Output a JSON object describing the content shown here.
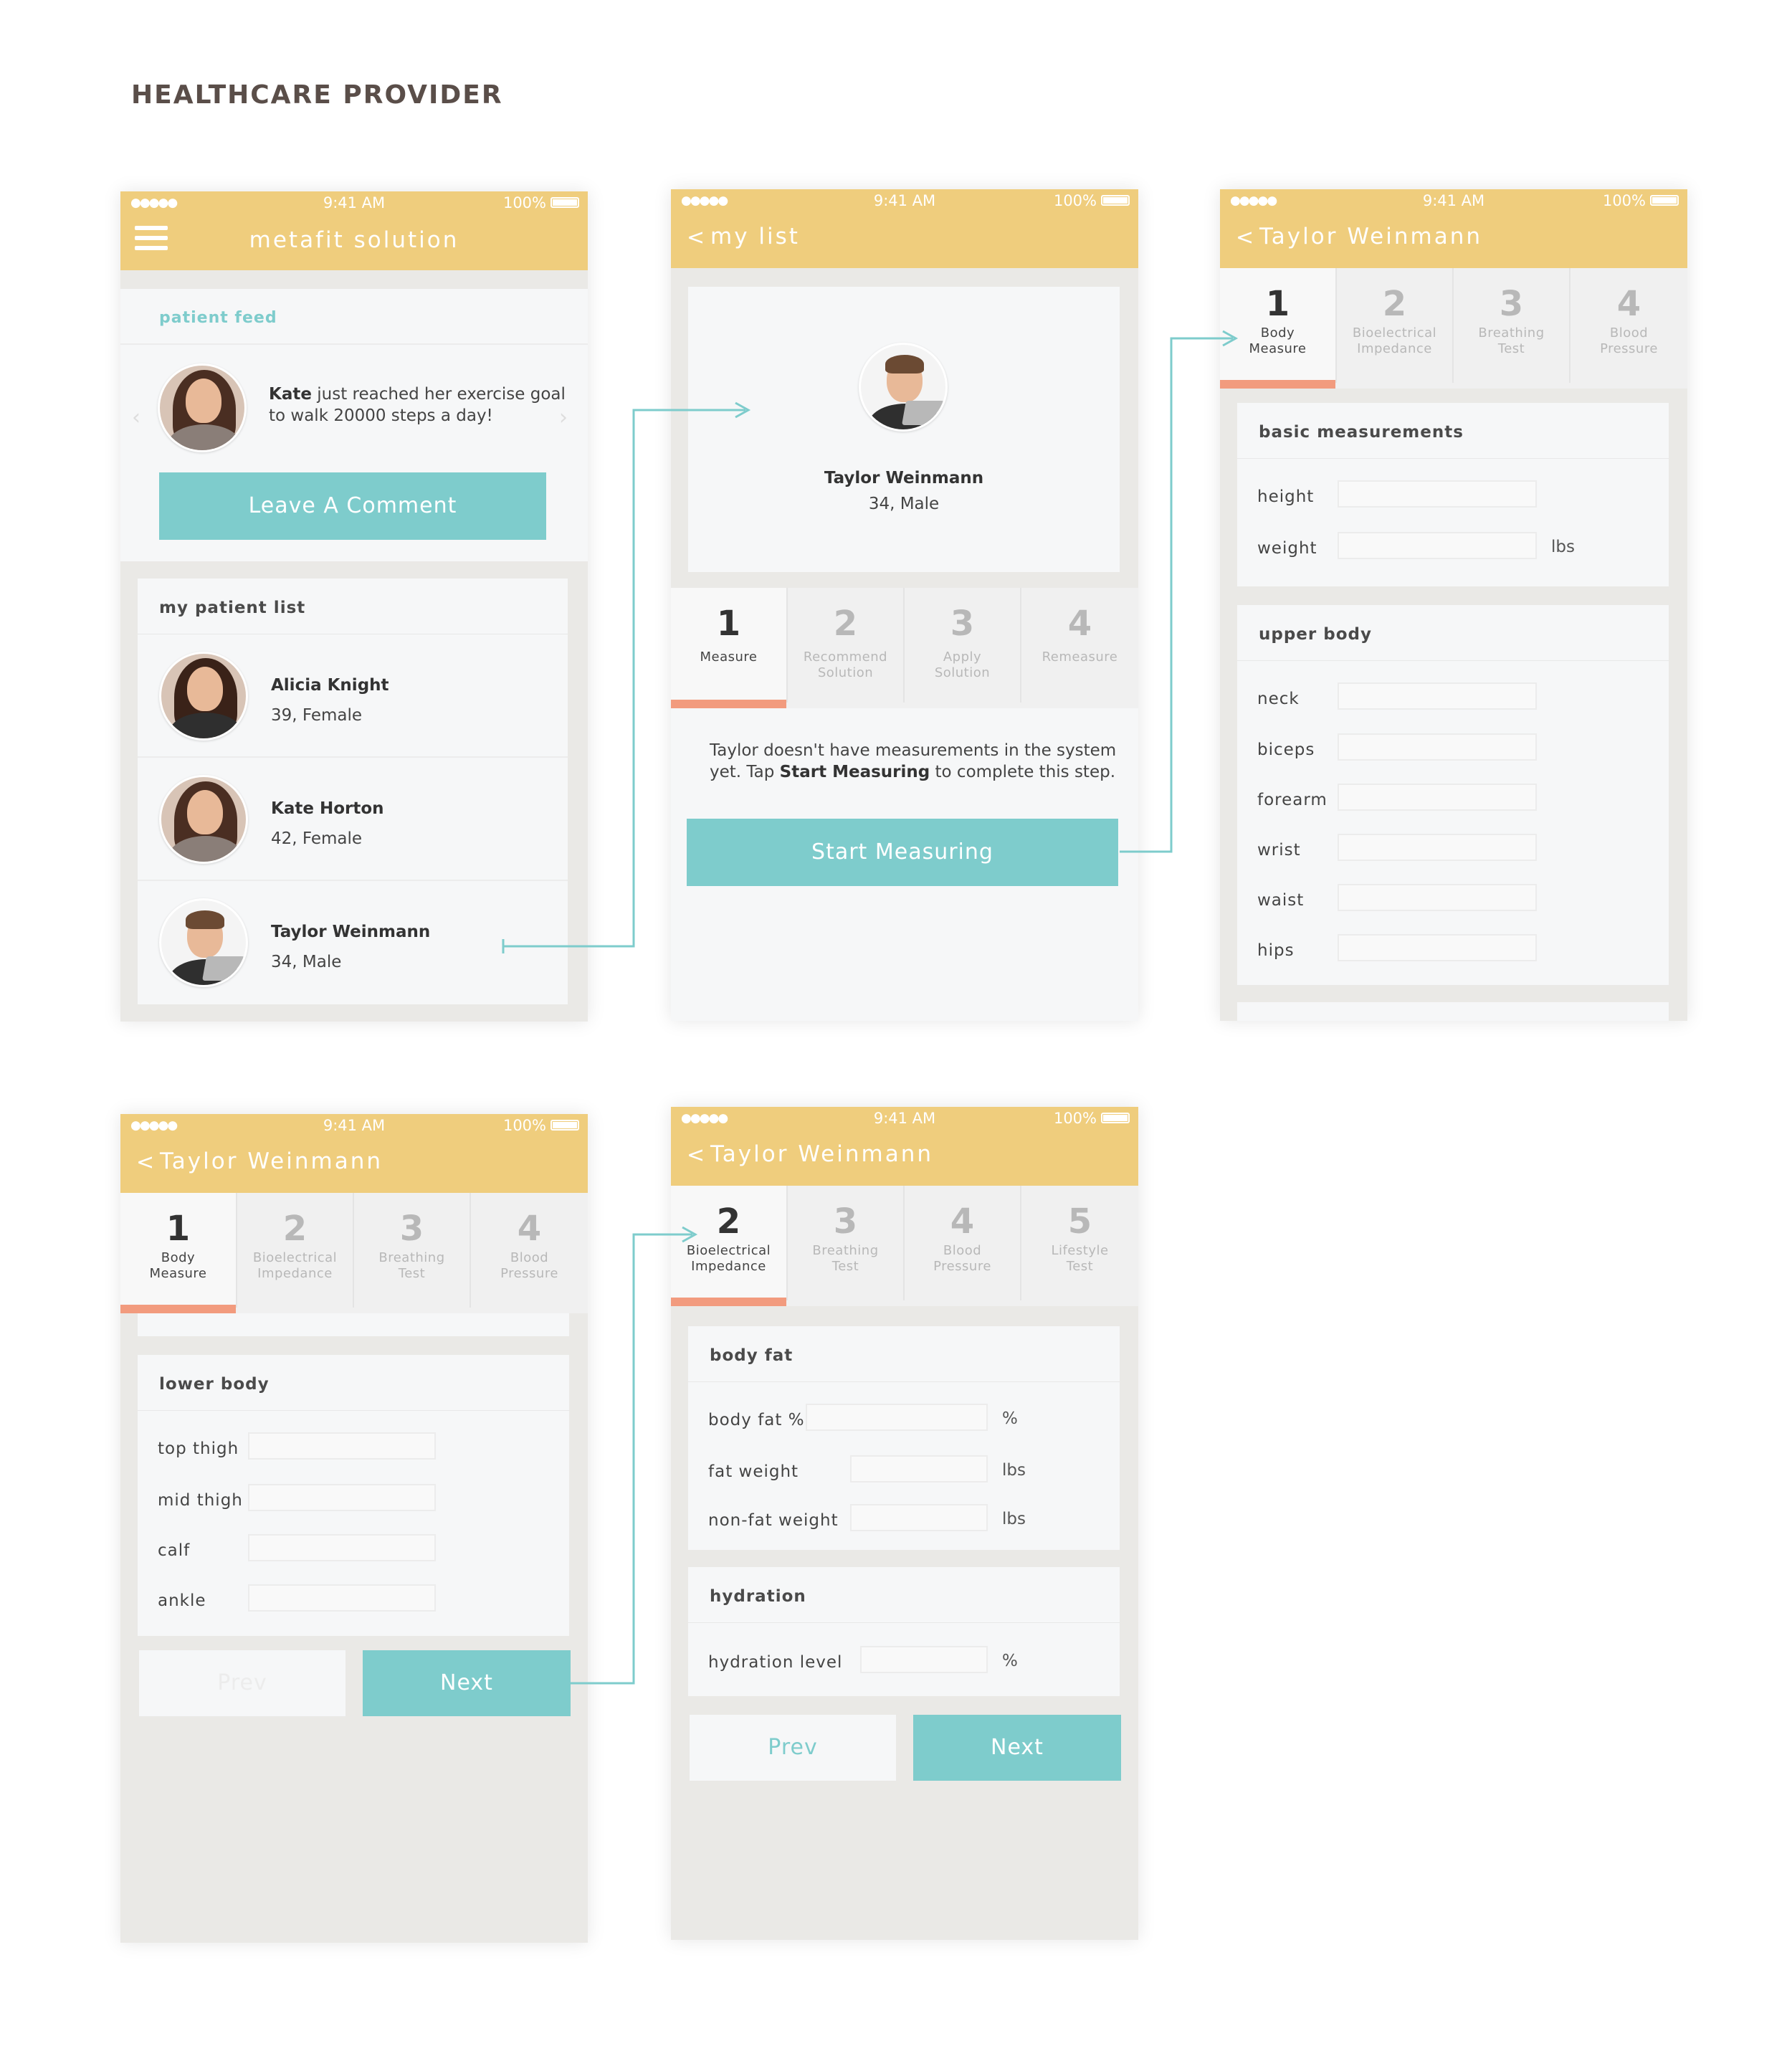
{
  "page_title": "HEALTHCARE PROVIDER",
  "status_bar": {
    "signal": "●●●●●",
    "time": "9:41 AM",
    "battery": "100%"
  },
  "accent_colors": {
    "header": "#efcd7d",
    "teal": "#7ecccc",
    "active_bar": "#f29b7e"
  },
  "screen1": {
    "title": "metafit solution",
    "feed": {
      "header": "patient feed",
      "message_name": "Kate",
      "message_line1": "just reached her exercise goal",
      "message_line2": "to walk 20000 steps a day!",
      "button": "Leave A Comment"
    },
    "patients": {
      "header": "my patient list",
      "items": [
        {
          "name": "Alicia Knight",
          "meta": "39, Female"
        },
        {
          "name": "Kate Horton",
          "meta": "42, Female"
        },
        {
          "name": "Taylor Weinmann",
          "meta": "34, Male"
        }
      ]
    }
  },
  "screen2": {
    "title": "my list",
    "profile_name": "Taylor Weinmann",
    "profile_meta": "34, Male",
    "tabs": [
      {
        "num": "1",
        "line1": "Measure",
        "line2": ""
      },
      {
        "num": "2",
        "line1": "Recommend",
        "line2": "Solution"
      },
      {
        "num": "3",
        "line1": "Apply",
        "line2": "Solution"
      },
      {
        "num": "4",
        "line1": "Remeasure",
        "line2": ""
      }
    ],
    "msg_part1": "Taylor doesn't have measurements in the system",
    "msg_part2": "yet. Tap",
    "msg_bold": "Start Measuring",
    "msg_part3": "to complete this step.",
    "button": "Start Measuring"
  },
  "screen3": {
    "title": "Taylor Weinmann",
    "tabs": [
      {
        "num": "1",
        "line1": "Body",
        "line2": "Measure"
      },
      {
        "num": "2",
        "line1": "Bioelectrical",
        "line2": "Impedance"
      },
      {
        "num": "3",
        "line1": "Breathing",
        "line2": "Test"
      },
      {
        "num": "4",
        "line1": "Blood",
        "line2": "Pressure"
      }
    ],
    "basic": {
      "header": "basic measurements",
      "height": "height",
      "weight": "weight",
      "weight_unit": "lbs"
    },
    "upper": {
      "header": "upper body",
      "fields": [
        "neck",
        "biceps",
        "forearm",
        "wrist",
        "waist",
        "hips"
      ]
    }
  },
  "screen4": {
    "title": "Taylor Weinmann",
    "tabs": [
      {
        "num": "1",
        "line1": "Body",
        "line2": "Measure"
      },
      {
        "num": "2",
        "line1": "Bioelectrical",
        "line2": "Impedance"
      },
      {
        "num": "3",
        "line1": "Breathing",
        "line2": "Test"
      },
      {
        "num": "4",
        "line1": "Blood",
        "line2": "Pressure"
      }
    ],
    "lower": {
      "header": "lower body",
      "fields": [
        "top thigh",
        "mid thigh",
        "calf",
        "ankle"
      ]
    },
    "prev": "Prev",
    "next": "Next"
  },
  "screen5": {
    "title": "Taylor Weinmann",
    "tabs": [
      {
        "num": "2",
        "line1": "Bioelectrical",
        "line2": "Impedance"
      },
      {
        "num": "3",
        "line1": "Breathing",
        "line2": "Test"
      },
      {
        "num": "4",
        "line1": "Blood",
        "line2": "Pressure"
      },
      {
        "num": "5",
        "line1": "Lifestyle",
        "line2": "Test"
      }
    ],
    "bodyfat": {
      "header": "body fat",
      "pct_label": "body fat %",
      "pct_unit": "%",
      "fat_label": "fat weight",
      "fat_unit": "lbs",
      "nonfat_label": "non-fat weight",
      "nonfat_unit": "lbs"
    },
    "hydration": {
      "header": "hydration",
      "label": "hydration level",
      "unit": "%"
    },
    "prev": "Prev",
    "next": "Next"
  }
}
